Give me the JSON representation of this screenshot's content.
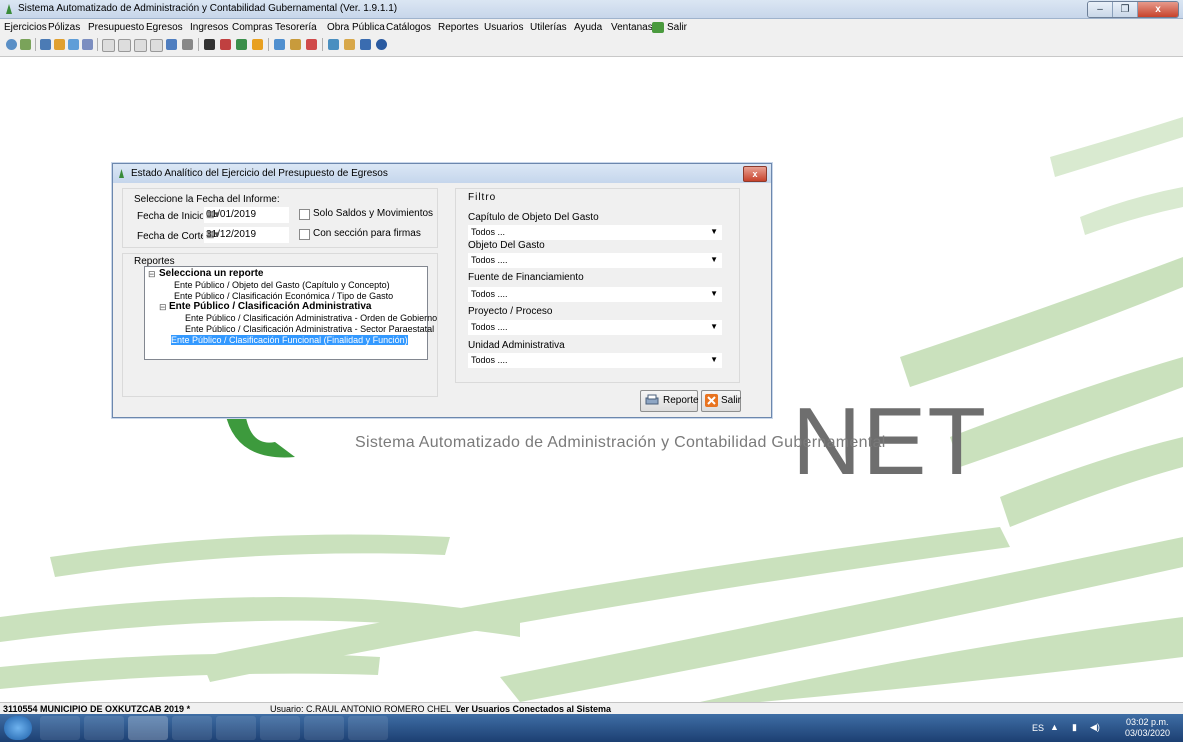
{
  "window": {
    "title": "Sistema Automatizado de Administración y Contabilidad Gubernamental  (Ver. 1.9.1.1)"
  },
  "menu": [
    "Ejercicios",
    "Pólizas",
    "Presupuesto",
    "Egresos",
    "Ingresos",
    "Compras",
    "Tesorería",
    "Obra Pública",
    "Catálogos",
    "Reportes",
    "Usuarios",
    "Utilerías",
    "Ayuda",
    "Ventanas",
    "Salir"
  ],
  "background": {
    "logo_text": "NET",
    "subtitle": "Sistema Automatizado de Administración y Contabilidad Gubernamental"
  },
  "dialog": {
    "title": "Estado Analítico del Ejercicio del Presupuesto de Egresos",
    "close": "x",
    "fecha_label": "Seleccione la Fecha del Informe:",
    "inicio_label": "Fecha de Inicio:",
    "inicio_value": "01/01/2019",
    "corte_label": "Fecha de Corte:",
    "corte_value": "31/12/2019",
    "chk_saldos": "Solo Saldos y Movimientos",
    "chk_firmas": "Con sección para firmas",
    "reportes_label": "Reportes",
    "tree": {
      "root": "Selecciona un reporte",
      "item1": "Ente Público / Objeto del Gasto (Capítulo y Concepto)",
      "item2": "Ente Público / Clasificación Económica / Tipo de Gasto",
      "item3": "Ente Público / Clasificación Administrativa",
      "item3a": "Ente Público / Clasificación Administrativa - Orden de Gobierno",
      "item3b": "Ente Público / Clasificación Administrativa - Sector Paraestatal",
      "item4": "Ente Público / Clasificación Funcional (Finalidad y Función)"
    },
    "filtro_label": "Filtro",
    "filters": [
      {
        "label": "Capítulo de Objeto Del Gasto",
        "value": "Todos  ..."
      },
      {
        "label": "Objeto Del Gasto",
        "value": "Todos ...."
      },
      {
        "label": "Fuente de Financiamiento",
        "value": "Todos ...."
      },
      {
        "label": "Proyecto / Proceso",
        "value": "Todos ...."
      },
      {
        "label": "Unidad Administrativa",
        "value": "Todos ...."
      }
    ],
    "btn_reporte": "Reporte",
    "btn_salir": "Salir"
  },
  "status": {
    "entity": "3110554 MUNICIPIO DE OXKUTZCAB  2019  *",
    "user": "Usuario: C.RAUL ANTONIO ROMERO CHEL",
    "link": "Ver Usuarios Conectados al Sistema"
  },
  "tray": {
    "lang": "ES",
    "time": "03:02 p.m.",
    "date": "03/03/2020"
  }
}
